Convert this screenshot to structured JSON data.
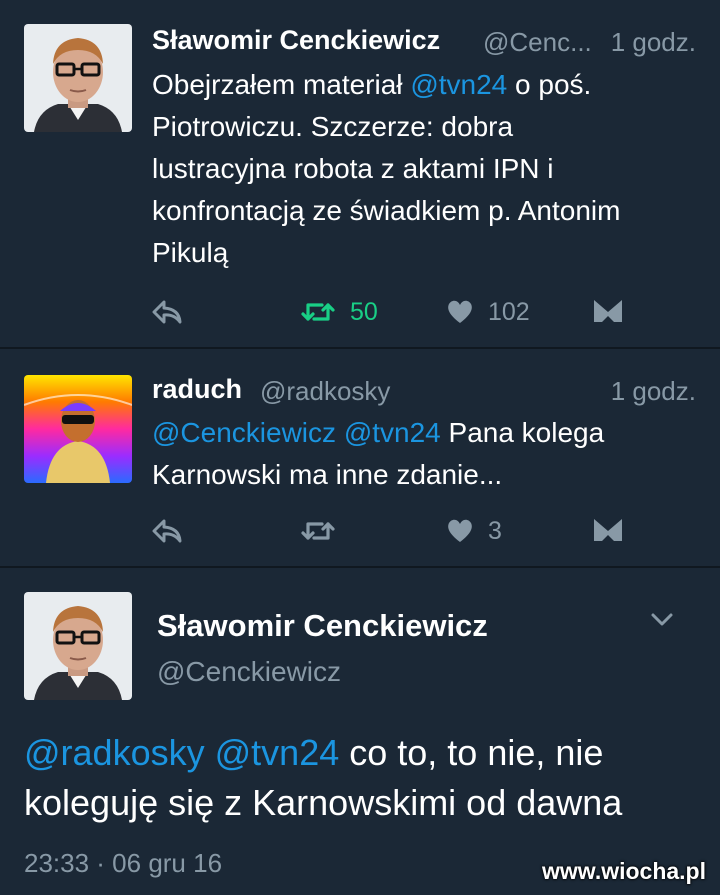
{
  "tweets": [
    {
      "name": "Sławomir Cenckiewicz",
      "handle": "@Cenc...",
      "time": "1 godz.",
      "text_lines": [
        [
          {
            "t": "Obejrzałem materiał ",
            "m": false
          },
          {
            "t": "@tvn24",
            "m": true
          },
          {
            "t": " o poś.",
            "m": false
          }
        ],
        [
          {
            "t": "Piotrowiczu. Szczerze: dobra",
            "m": false
          }
        ],
        [
          {
            "t": "lustracyjna robota z aktami IPN i",
            "m": false
          }
        ],
        [
          {
            "t": "konfrontacją ze świadkiem p. Antonim",
            "m": false
          }
        ],
        [
          {
            "t": "Pikulą",
            "m": false
          }
        ]
      ],
      "retweets": "50",
      "likes": "102",
      "retweeted": true
    },
    {
      "name": "raduch",
      "handle": "@radkosky",
      "time": "1 godz.",
      "text_lines": [
        [
          {
            "t": "@Cenckiewicz",
            "m": true
          },
          {
            "t": " ",
            "m": false
          },
          {
            "t": "@tvn24",
            "m": true
          },
          {
            "t": " Pana kolega",
            "m": false
          }
        ],
        [
          {
            "t": "Karnowski ma inne zdanie...",
            "m": false
          }
        ]
      ],
      "retweets": "",
      "likes": "3",
      "retweeted": false
    }
  ],
  "detail": {
    "name": "Sławomir Cenckiewicz",
    "handle": "@Cenckiewicz",
    "text_lines": [
      [
        {
          "t": "@radkosky",
          "m": true
        },
        {
          "t": " ",
          "m": false
        },
        {
          "t": "@tvn24",
          "m": true
        },
        {
          "t": " co to, to nie, nie",
          "m": false
        }
      ],
      [
        {
          "t": "koleguję się z Karnowskimi od dawna",
          "m": false
        }
      ]
    ],
    "timestamp": "23:33 · 06 gru 16"
  },
  "watermark": "www.wiocha.pl",
  "icons": {
    "reply": "reply-icon",
    "retweet": "retweet-icon",
    "like": "heart-icon",
    "dm": "direct-message-icon",
    "more": "chevron-down-icon"
  },
  "colors": {
    "background": "#1b2836",
    "mention": "#1b95e0",
    "retweet_active": "#19cf86",
    "muted": "#8899a6"
  }
}
